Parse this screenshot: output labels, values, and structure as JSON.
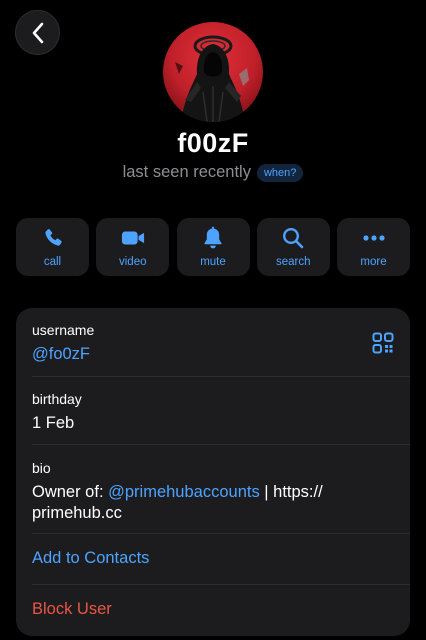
{
  "header": {
    "back_icon": "chevron-left-icon"
  },
  "profile": {
    "avatar_icon": "dark-hooded-figure-avatar",
    "name": "f00zF",
    "last_seen": "last seen recently",
    "when_badge": "when?"
  },
  "actions": [
    {
      "label": "call",
      "icon": "phone-icon"
    },
    {
      "label": "video",
      "icon": "video-camera-icon"
    },
    {
      "label": "mute",
      "icon": "bell-icon"
    },
    {
      "label": "search",
      "icon": "magnifier-icon"
    },
    {
      "label": "more",
      "icon": "ellipsis-icon"
    }
  ],
  "info": {
    "username_label": "username",
    "username_value": "@fo0zF",
    "qr_icon": "qr-code-icon",
    "birthday_label": "birthday",
    "birthday_value": "1 Feb",
    "bio_label": "bio",
    "bio_prefix": "Owner of: ",
    "bio_link": "@primehubaccounts",
    "bio_suffix": " | https://",
    "bio_line2": "primehub.cc",
    "add_contact": "Add to Contacts",
    "block_user": "Block User"
  },
  "colors": {
    "background": "#000000",
    "surface": "#1c1c1e",
    "accent": "#4da3ff",
    "destructive": "#eb5545",
    "secondary_text": "#8e8e93"
  }
}
